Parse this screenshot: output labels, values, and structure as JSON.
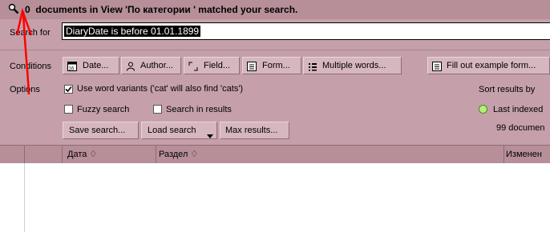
{
  "status": {
    "count": "0",
    "message": "documents in View 'По категории ' matched your search."
  },
  "search": {
    "label": "Search for",
    "query": "DiaryDate is before 01.01.1899"
  },
  "conditions": {
    "label": "Conditions",
    "buttons": [
      "Date...",
      "Author...",
      "Field...",
      "Form...",
      "Multiple words..."
    ],
    "fill_example": "Fill out example form..."
  },
  "options": {
    "label": "Options",
    "use_word_variants": "Use word variants ('cat' will also find 'cats')",
    "fuzzy_search": "Fuzzy search",
    "search_in_results": "Search in results",
    "save_search": "Save search...",
    "load_search": "Load search",
    "max_results": "Max results..."
  },
  "sort": {
    "label": "Sort results by",
    "selected": "Last indexed",
    "count_text": "99  documen"
  },
  "columns": [
    "Дата",
    "Раздел",
    "Изменен"
  ],
  "colors": {
    "panel": "#c5a0aa",
    "header": "#b78f99",
    "annotation": "#ff0000"
  }
}
